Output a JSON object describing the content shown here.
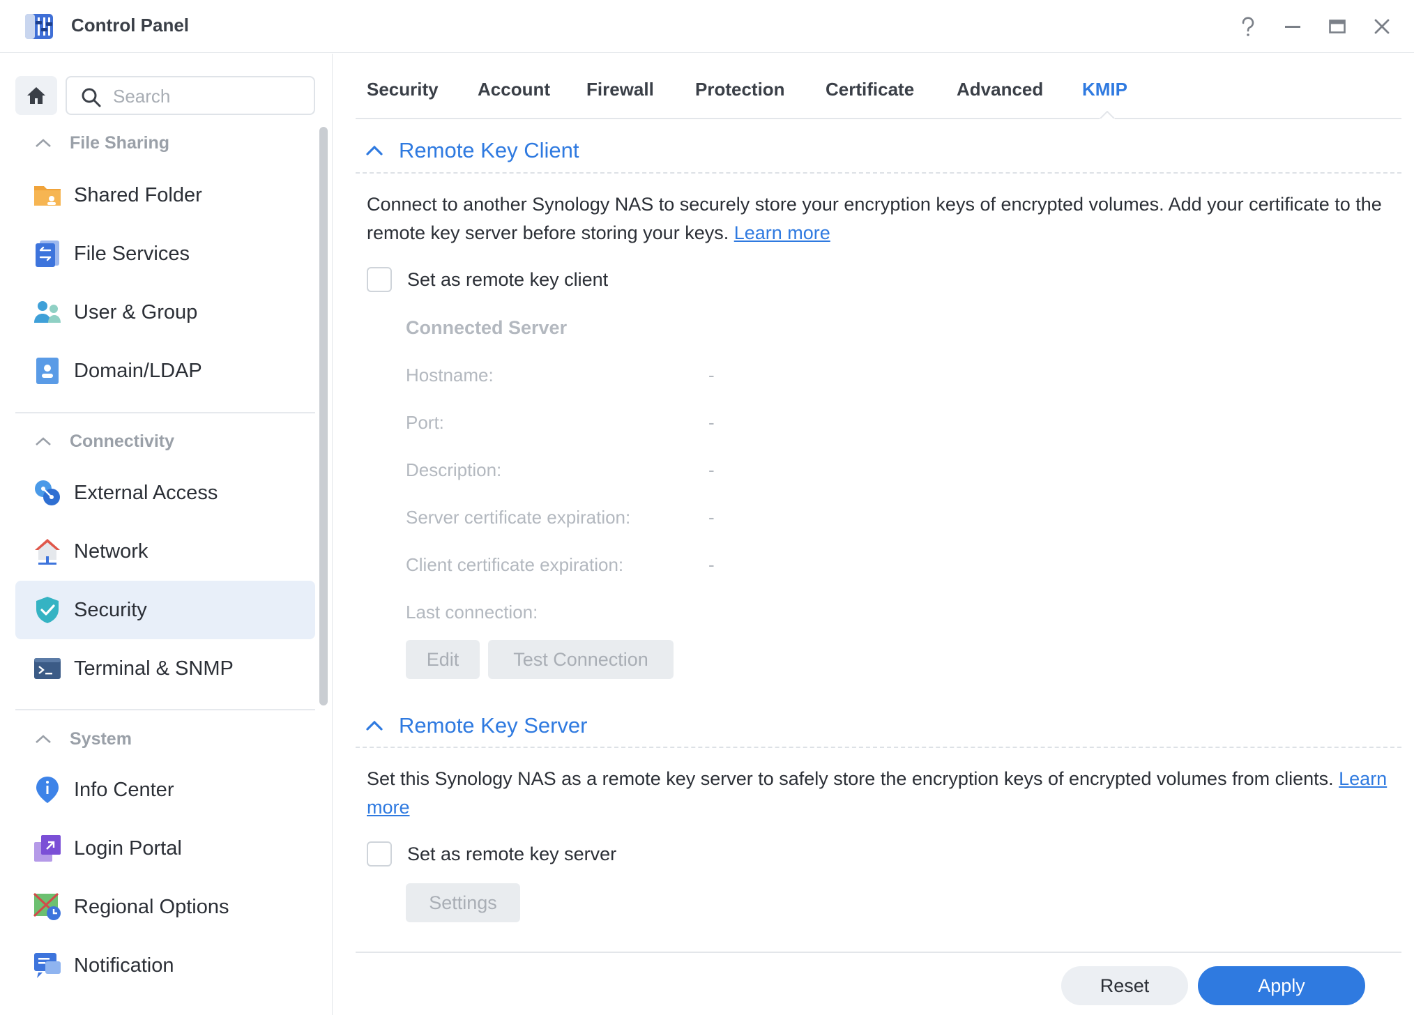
{
  "window": {
    "title": "Control Panel",
    "icons": [
      "help-icon",
      "minimize-icon",
      "maximize-icon",
      "close-icon"
    ]
  },
  "sidebar": {
    "search_placeholder": "Search",
    "groups": [
      {
        "label": "File Sharing",
        "items": [
          {
            "label": "Shared Folder",
            "icon": "shared-folder-icon"
          },
          {
            "label": "File Services",
            "icon": "file-services-icon"
          },
          {
            "label": "User & Group",
            "icon": "user-group-icon"
          },
          {
            "label": "Domain/LDAP",
            "icon": "domain-ldap-icon"
          }
        ]
      },
      {
        "label": "Connectivity",
        "items": [
          {
            "label": "External Access",
            "icon": "external-access-icon"
          },
          {
            "label": "Network",
            "icon": "network-icon"
          },
          {
            "label": "Security",
            "icon": "security-shield-icon",
            "active": true
          },
          {
            "label": "Terminal & SNMP",
            "icon": "terminal-icon"
          }
        ]
      },
      {
        "label": "System",
        "items": [
          {
            "label": "Info Center",
            "icon": "info-center-icon"
          },
          {
            "label": "Login Portal",
            "icon": "login-portal-icon"
          },
          {
            "label": "Regional Options",
            "icon": "regional-options-icon"
          },
          {
            "label": "Notification",
            "icon": "notification-icon"
          }
        ]
      }
    ]
  },
  "tabs": [
    {
      "label": "Security"
    },
    {
      "label": "Account"
    },
    {
      "label": "Firewall"
    },
    {
      "label": "Protection"
    },
    {
      "label": "Certificate"
    },
    {
      "label": "Advanced"
    },
    {
      "label": "KMIP",
      "active": true
    }
  ],
  "client": {
    "title": "Remote Key Client",
    "description": "Connect to another Synology NAS to securely store your encryption keys of encrypted volumes. Add your certificate to the remote key server before storing your keys.",
    "learn_more": "Learn more",
    "checkbox_label": "Set as remote key client",
    "checked": false,
    "connected_server_title": "Connected Server",
    "fields": [
      {
        "label": "Hostname:",
        "value": "-"
      },
      {
        "label": "Port:",
        "value": "-"
      },
      {
        "label": "Description:",
        "value": "-"
      },
      {
        "label": "Server certificate expiration:",
        "value": "-"
      },
      {
        "label": "Client certificate expiration:",
        "value": "-"
      },
      {
        "label": "Last connection:",
        "value": ""
      }
    ],
    "edit_label": "Edit",
    "test_label": "Test Connection"
  },
  "server": {
    "title": "Remote Key Server",
    "description": "Set this Synology NAS as a remote key server to safely store the encryption keys of encrypted volumes from clients.",
    "learn_more": "Learn more",
    "checkbox_label": "Set as remote key server",
    "checked": false,
    "settings_label": "Settings"
  },
  "footer": {
    "reset_label": "Reset",
    "apply_label": "Apply"
  },
  "colors": {
    "accent": "#2f7ae0",
    "active_nav_bg": "#e8eff9",
    "disabled_text": "#b3b8bf"
  }
}
